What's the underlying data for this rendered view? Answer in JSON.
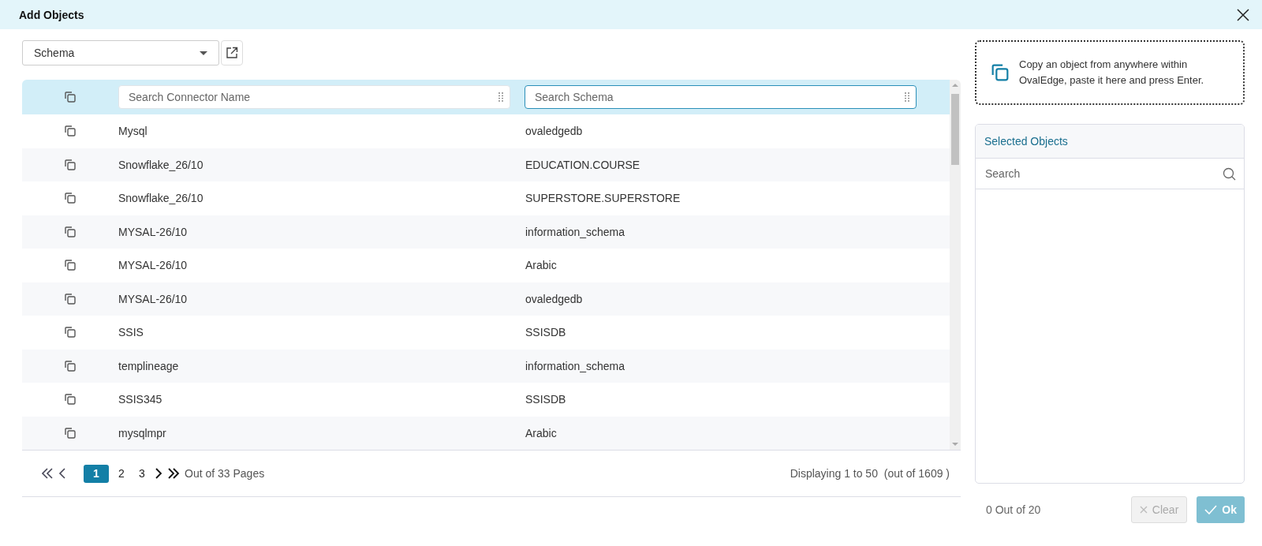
{
  "window": {
    "title": "Add Objects"
  },
  "type_select": {
    "value": "Schema"
  },
  "table": {
    "filters": [
      {
        "placeholder": "Search Connector Name",
        "focused": false
      },
      {
        "placeholder": "Search Schema",
        "focused": true
      }
    ],
    "rows": [
      {
        "connector": "Mysql",
        "schema": "ovaledgedb"
      },
      {
        "connector": "Snowflake_26/10",
        "schema": "EDUCATION.COURSE"
      },
      {
        "connector": "Snowflake_26/10",
        "schema": "SUPERSTORE.SUPERSTORE"
      },
      {
        "connector": "MYSAL-26/10",
        "schema": "information_schema"
      },
      {
        "connector": "MYSAL-26/10",
        "schema": "Arabic"
      },
      {
        "connector": "MYSAL-26/10",
        "schema": "ovaledgedb"
      },
      {
        "connector": "SSIS",
        "schema": "SSISDB"
      },
      {
        "connector": "templineage",
        "schema": "information_schema"
      },
      {
        "connector": "SSIS345",
        "schema": "SSISDB"
      },
      {
        "connector": "mysqlmpr",
        "schema": "Arabic"
      }
    ]
  },
  "pagination": {
    "pages": [
      {
        "label": "1",
        "selected": true
      },
      {
        "label": "2",
        "selected": false
      },
      {
        "label": "3",
        "selected": false
      }
    ],
    "summary": "Out of 33 Pages",
    "displaying": "Displaying 1 to 50  (out of 1609 )"
  },
  "paste_box": {
    "text": "Copy an object from anywhere within OvalEdge, paste it here and press Enter."
  },
  "selected_objects": {
    "title": "Selected Objects",
    "search_placeholder": "Search",
    "count": "0 Out of 20"
  },
  "buttons": [
    {
      "label": "Clear",
      "kind": "clear",
      "disabled": true
    },
    {
      "label": "Ok",
      "kind": "ok",
      "disabled": true
    }
  ]
}
